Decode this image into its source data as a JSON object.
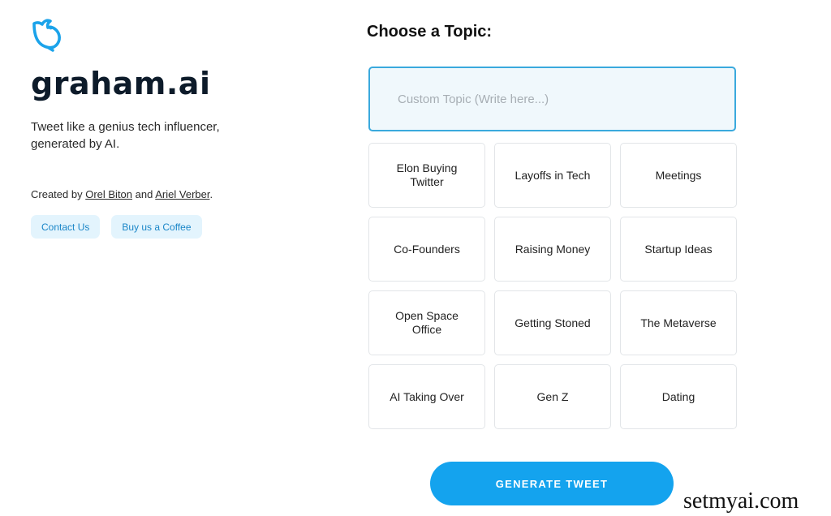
{
  "brand": {
    "logo_icon": "bird-icon",
    "name": "graham.ai",
    "tagline": "Tweet like a genius tech influencer, generated by AI.",
    "accent_color": "#14a3ee"
  },
  "credits": {
    "prefix": "Created by",
    "author1": "Orel Biton",
    "joiner": "and",
    "author2": "Ariel Verber",
    "suffix": "."
  },
  "links": {
    "contact": "Contact Us",
    "coffee": "Buy us a Coffee"
  },
  "main": {
    "heading": "Choose a Topic:",
    "custom_placeholder": "Custom Topic (Write here...)",
    "custom_value": "",
    "topics": [
      "Elon Buying Twitter",
      "Layoffs in Tech",
      "Meetings",
      "Co-Founders",
      "Raising Money",
      "Startup Ideas",
      "Open Space Office",
      "Getting Stoned",
      "The Metaverse",
      "AI Taking Over",
      "Gen Z",
      "Dating"
    ],
    "generate_label": "GENERATE TWEET"
  },
  "watermark": "setmyai.com"
}
